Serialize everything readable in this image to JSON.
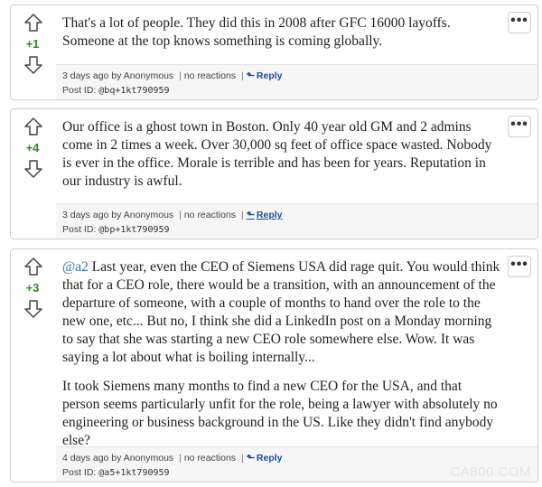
{
  "posts": [
    {
      "score": "+1",
      "paragraphs": [
        "That's a lot of people. They did this in 2008 after GFC 16000 layoffs. Someone at the top knows something is coming globally."
      ],
      "time": "3 days ago",
      "author_prefix": "by",
      "author": "Anonymous",
      "reactions": "no reactions",
      "reply_label": "Reply",
      "post_id_label": "Post ID:",
      "post_id": "@bq+1kt790959"
    },
    {
      "score": "+4",
      "paragraphs": [
        "Our office is a ghost town in Boston. Only 40 year old GM and 2 admins come in 2 times a week. Over 30,000 sq feet of office space wasted. Nobody is ever in the office. Morale is terrible and has been for years. Reputation in our industry is awful."
      ],
      "time": "3 days ago",
      "author_prefix": "by",
      "author": "Anonymous",
      "reactions": "no reactions",
      "reply_label": "Reply",
      "post_id_label": "Post ID:",
      "post_id": "@bp+1kt790959"
    },
    {
      "score": "+3",
      "mention": "@a2",
      "paragraphs": [
        "Last year, even the CEO of Siemens USA did rage quit. You would think that for a CEO role, there would be a transition, with an announcement of the departure of someone, with a couple of months to hand over the role to the new one, etc... But no, I think she did a LinkedIn post on a Monday morning to say that she was starting a new CEO role somewhere else. Wow. It was saying a lot about what is boiling internally...",
        "It took Siemens many months to find a new CEO for the USA, and that person seems particularly unfit for the role, being a lawyer with absolutely no engineering or business background in the US. Like they didn't find anybody else?"
      ],
      "time": "4 days ago",
      "author_prefix": "by",
      "author": "Anonymous",
      "reactions": "no reactions",
      "reply_label": "Reply",
      "post_id_label": "Post ID:",
      "post_id": "@a5+1kt790959"
    }
  ],
  "more_label": "•••",
  "separator": "|",
  "watermark": "CA800.COM",
  "colors": {
    "score_green": "#2e8b20",
    "reply_blue": "#1a4d99",
    "mention_blue": "#3a6fb0"
  },
  "icons": {
    "upvote": "upvote-arrow-icon",
    "downvote": "downvote-arrow-icon",
    "more": "more-options-icon",
    "reply": "reply-arrow-icon"
  }
}
